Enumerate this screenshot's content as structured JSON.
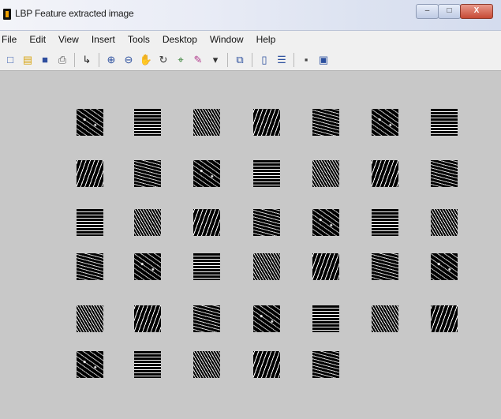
{
  "window": {
    "title": "LBP Feature extracted image",
    "minimize_label": "–",
    "maximize_label": "□",
    "close_label": "X"
  },
  "menu": [
    "File",
    "Edit",
    "View",
    "Insert",
    "Tools",
    "Desktop",
    "Window",
    "Help"
  ],
  "toolbar": {
    "icons": [
      {
        "name": "new-figure-icon",
        "glyph": "□",
        "color": "#3a5fb0"
      },
      {
        "name": "open-file-icon",
        "glyph": "▤",
        "color": "#d8a514"
      },
      {
        "name": "save-icon",
        "glyph": "■",
        "color": "#2f4e9e"
      },
      {
        "name": "print-icon",
        "glyph": "⎙",
        "color": "#555555"
      },
      {
        "name": "sep"
      },
      {
        "name": "edit-plot-arrow-icon",
        "glyph": "↳",
        "color": "#222222"
      },
      {
        "name": "sep"
      },
      {
        "name": "zoom-in-icon",
        "glyph": "⊕",
        "color": "#2b4f9e"
      },
      {
        "name": "zoom-out-icon",
        "glyph": "⊖",
        "color": "#2b4f9e"
      },
      {
        "name": "pan-hand-icon",
        "glyph": "✋",
        "color": "#8a6d2f"
      },
      {
        "name": "rotate-3d-icon",
        "glyph": "↻",
        "color": "#333333"
      },
      {
        "name": "data-cursor-icon",
        "glyph": "⌖",
        "color": "#2b7a2b"
      },
      {
        "name": "brush-icon",
        "glyph": "✎",
        "color": "#b03a8c"
      },
      {
        "name": "brush-dropdown-icon",
        "glyph": "▾",
        "color": "#333333"
      },
      {
        "name": "sep"
      },
      {
        "name": "link-plot-icon",
        "glyph": "⧉",
        "color": "#2b4f9e"
      },
      {
        "name": "sep"
      },
      {
        "name": "insert-colorbar-icon",
        "glyph": "▯",
        "color": "#2b4f9e"
      },
      {
        "name": "insert-legend-icon",
        "glyph": "☰",
        "color": "#2b4f9e"
      },
      {
        "name": "sep"
      },
      {
        "name": "hide-plot-tools-icon",
        "glyph": "▪",
        "color": "#444444"
      },
      {
        "name": "show-plot-tools-icon",
        "glyph": "▣",
        "color": "#2b4f9e"
      }
    ]
  },
  "tiles": {
    "rows": [
      7,
      7,
      7,
      7,
      7,
      5
    ],
    "count": 40,
    "patterns": [
      "noise-a",
      "noise-b",
      "noise-c",
      "noise-d",
      "noise-e"
    ]
  }
}
